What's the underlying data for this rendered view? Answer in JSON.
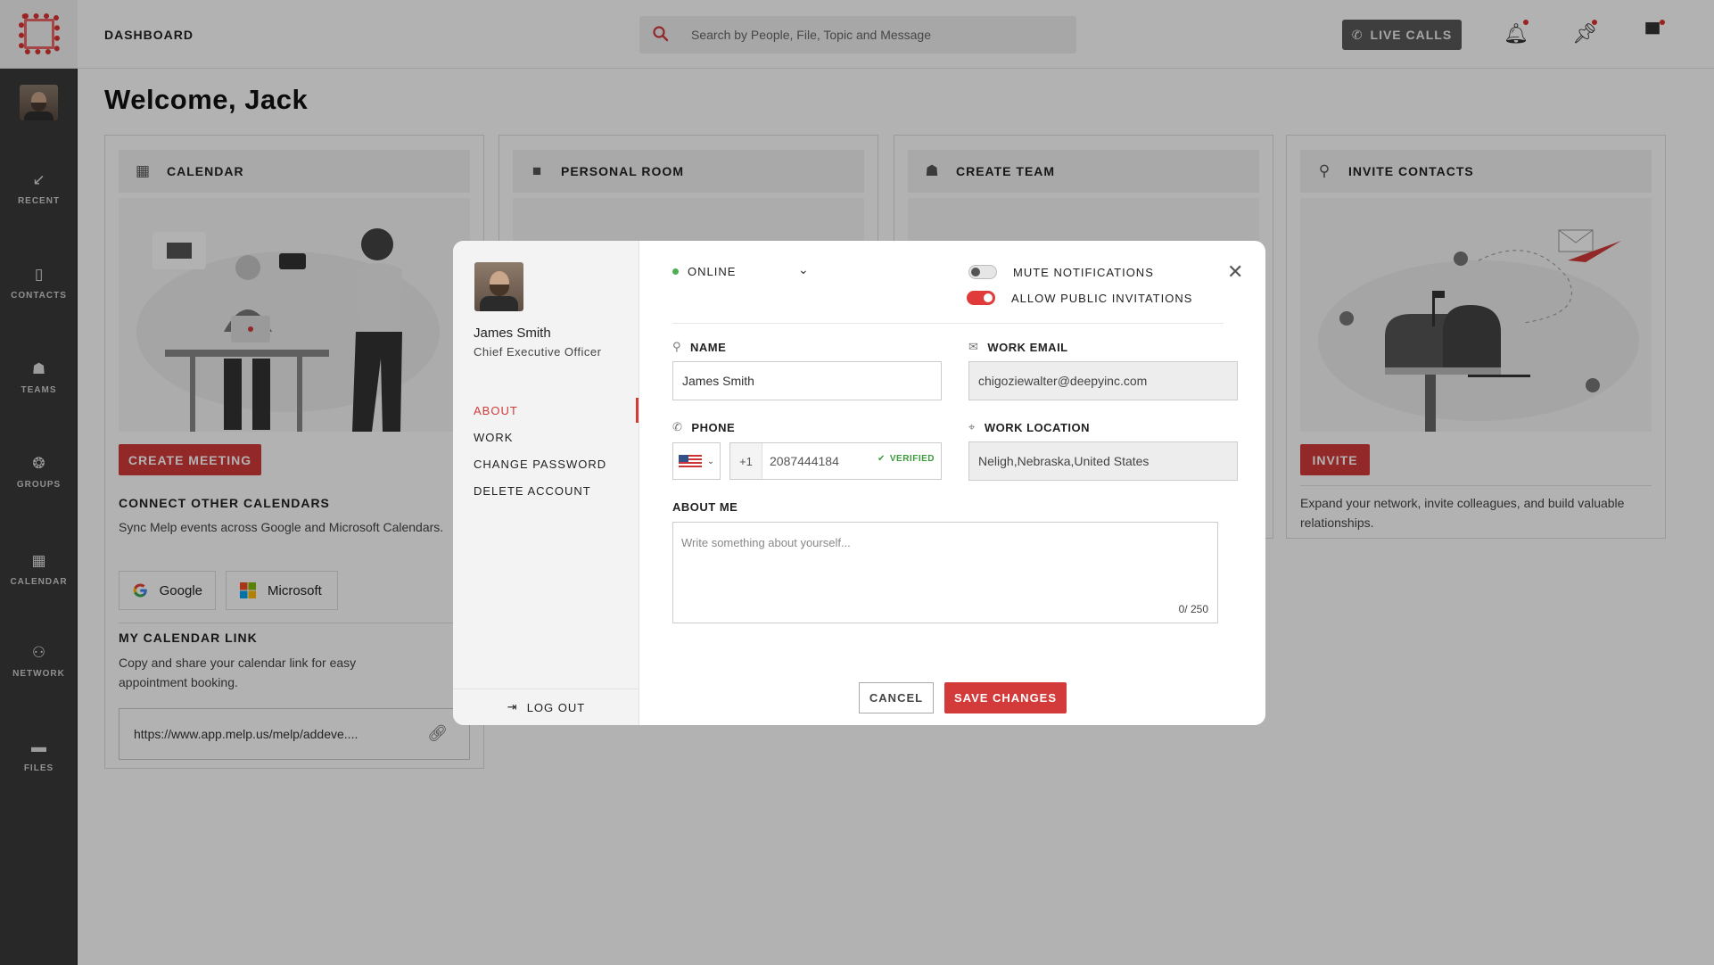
{
  "sidebar": {
    "items": [
      {
        "label": "RECENT",
        "icon": "arrow-down-left-icon"
      },
      {
        "label": "CONTACTS",
        "icon": "contacts-icon"
      },
      {
        "label": "TEAMS",
        "icon": "teams-icon"
      },
      {
        "label": "GROUPS",
        "icon": "groups-icon"
      },
      {
        "label": "CALENDAR",
        "icon": "calendar-icon"
      },
      {
        "label": "NETWORK",
        "icon": "network-icon"
      },
      {
        "label": "FILES",
        "icon": "folder-icon"
      }
    ]
  },
  "header": {
    "title": "DASHBOARD",
    "search_placeholder": "Search by People, File, Topic and Message",
    "live_calls_label": "LIVE CALLS"
  },
  "page": {
    "welcome": "Welcome, Jack"
  },
  "cards": {
    "calendar": {
      "title": "CALENDAR",
      "create_meeting": "CREATE MEETING",
      "connect_title": "CONNECT OTHER CALENDARS",
      "connect_text": "Sync Melp events across Google and Microsoft Calendars.",
      "google_label": "Google",
      "microsoft_label": "Microsoft",
      "link_title": "MY CALENDAR LINK",
      "link_text": "Copy and share your calendar link for easy appointment booking.",
      "link_url": "https://www.app.melp.us/melp/addeve...."
    },
    "personal_room": {
      "title": "PERSONAL ROOM"
    },
    "create_team": {
      "title": "CREATE TEAM"
    },
    "invite_contacts": {
      "title": "INVITE CONTACTS",
      "invite_label": "INVITE",
      "text": "Expand your network, invite colleagues, and build valuable relationships."
    }
  },
  "modal": {
    "user": {
      "name": "James Smith",
      "role": "Chief Executive Officer"
    },
    "nav": [
      "ABOUT",
      "WORK",
      "CHANGE PASSWORD",
      "DELETE ACCOUNT"
    ],
    "active_nav": "ABOUT",
    "logout_label": "LOG OUT",
    "status": "ONLINE",
    "mute_notifications": {
      "label": "MUTE NOTIFICATIONS",
      "on": false
    },
    "allow_public_invitations": {
      "label": "ALLOW PUBLIC INVITATIONS",
      "on": true
    },
    "fields": {
      "name": {
        "label": "NAME",
        "value": "James Smith"
      },
      "work_email": {
        "label": "WORK EMAIL",
        "value": "chigoziewalter@deepyinc.com"
      },
      "phone": {
        "label": "PHONE",
        "country_code": "+1",
        "number": "2087444184",
        "verified_label": "VERIFIED"
      },
      "work_location": {
        "label": "WORK LOCATION",
        "value": "Neligh,Nebraska,United States"
      },
      "about_me": {
        "label": "ABOUT ME",
        "placeholder": "Write something about yourself...",
        "counter": "0/ 250"
      }
    },
    "cancel_label": "CANCEL",
    "save_label": "SAVE CHANGES"
  },
  "colors": {
    "accent": "#d33a3a",
    "sidebar": "#3a3a3a",
    "online": "#4caf50",
    "verified": "#3c9a3c"
  }
}
